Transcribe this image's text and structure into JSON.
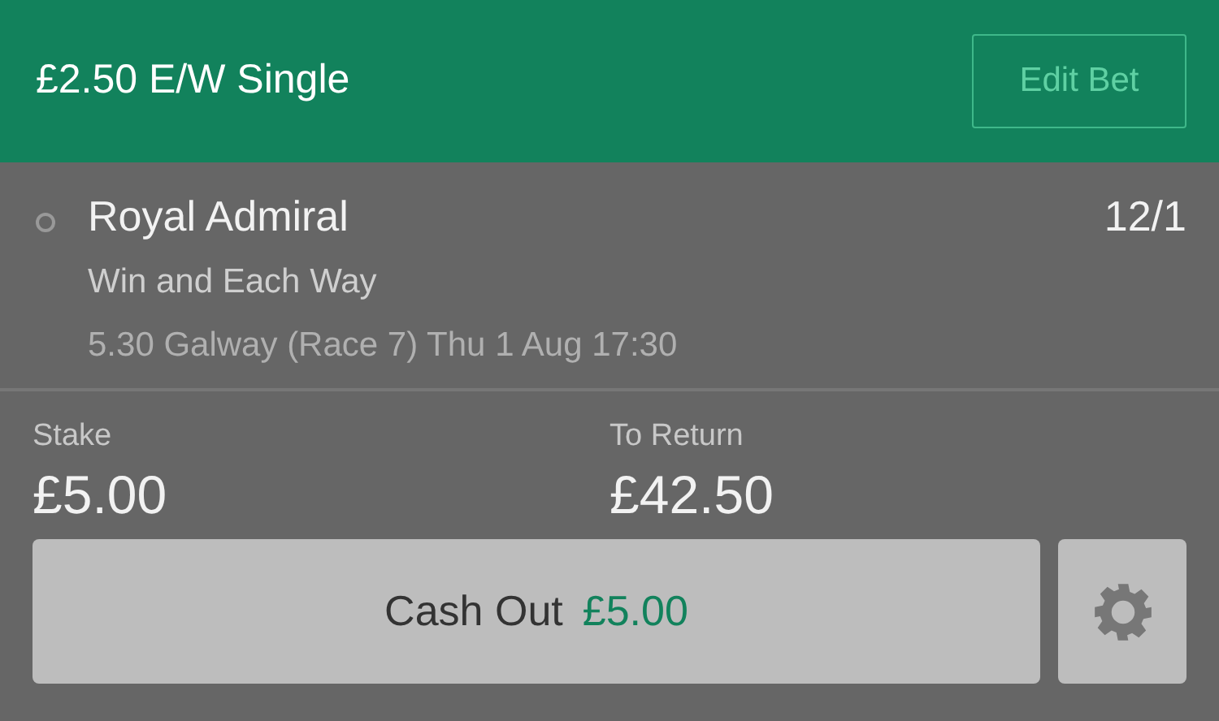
{
  "header": {
    "title": "£2.50 E/W Single",
    "edit_button": "Edit Bet"
  },
  "selection": {
    "name": "Royal Admiral",
    "odds": "12/1",
    "market": "Win and Each Way",
    "event": "5.30 Galway (Race 7) Thu 1 Aug 17:30"
  },
  "summary": [
    {
      "label": "Stake",
      "value": "£5.00"
    },
    {
      "label": "To Return",
      "value": "£42.50"
    }
  ],
  "cash_out": {
    "label": "Cash Out",
    "amount": "£5.00"
  }
}
